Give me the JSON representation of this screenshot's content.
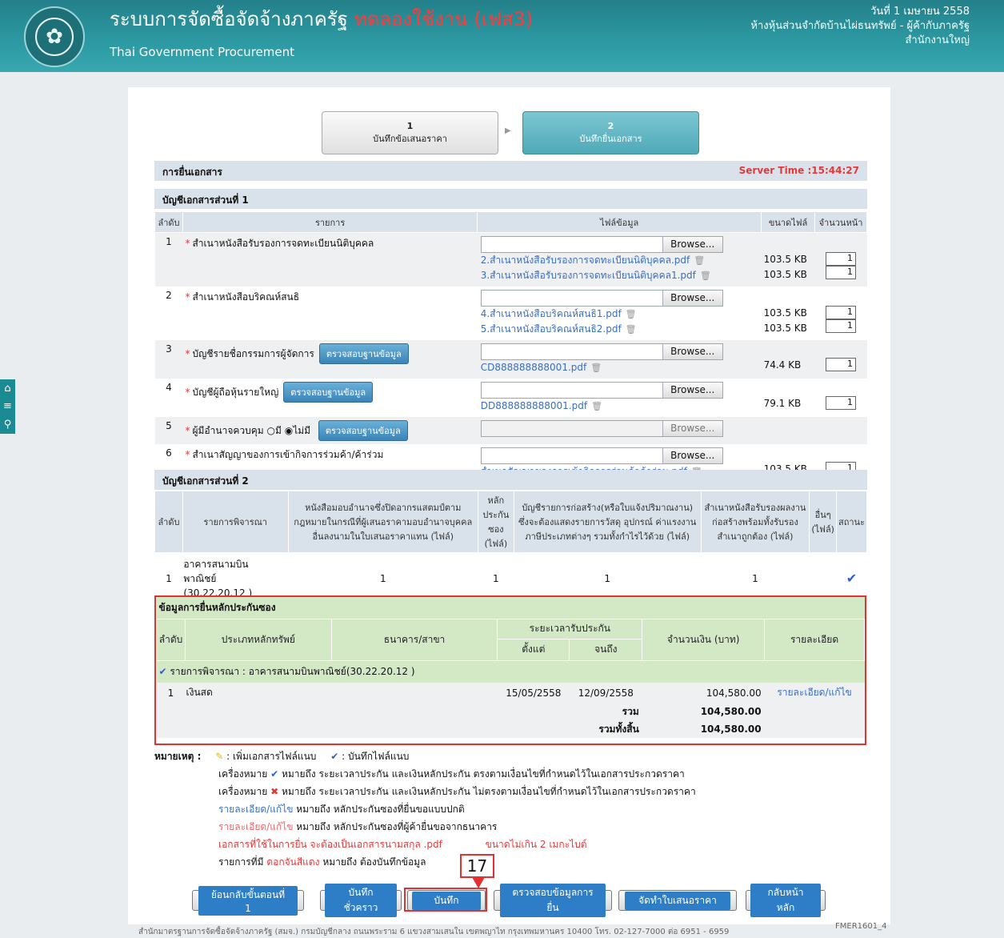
{
  "header": {
    "title": "ระบบการจัดซื้อจัดจ้างภาครัฐ",
    "title_test": "ทดลองใช้งาน (เฟส3)",
    "subtitle": "Thai Government Procurement",
    "date": "วันที่ 1 เมษายน 2558",
    "company": "ห้างหุ้นส่วนจำกัดบ้านไผ่ธนทรัพย์ - ผู้ค้ากับภาครัฐ",
    "branch": "สำนักงานใหญ่"
  },
  "steps": [
    {
      "num": "1",
      "label": "บันทึกข้อเสนอราคา"
    },
    {
      "num": "2",
      "label": "บันทึกยื่นเอกสาร"
    }
  ],
  "section_title": "การยื่นเอกสาร",
  "server_time": "Server Time :15:44:27",
  "part1": {
    "title": "บัญชีเอกสารส่วนที่ 1",
    "headers": [
      "ลำดับ",
      "รายการ",
      "ไฟล์ข้อมูล",
      "ขนาดไฟล์",
      "จำนวนหน้า"
    ],
    "browse": "Browse...",
    "verify": "ตรวจสอบฐานข้อมูล",
    "rows": [
      {
        "no": "1",
        "name": "สำเนาหนังสือรับรองการจดทะเบียนนิติบุคคล",
        "files": [
          {
            "name": "2.สำเนาหนังสือรับรองการจดทะเบียนนิติบุคคล.pdf",
            "size": "103.5 KB",
            "pages": "1"
          },
          {
            "name": "3.สำเนาหนังสือรับรองการจดทะเบียนนิติบุคคล1.pdf",
            "size": "103.5 KB",
            "pages": "1"
          }
        ]
      },
      {
        "no": "2",
        "name": "สำเนาหนังสือบริคณห์สนธิ",
        "files": [
          {
            "name": "4.สำเนาหนังสือบริคณห์สนธิ1.pdf",
            "size": "103.5 KB",
            "pages": "1"
          },
          {
            "name": "5.สำเนาหนังสือบริคณห์สนธิ2.pdf",
            "size": "103.5 KB",
            "pages": "1"
          }
        ]
      },
      {
        "no": "3",
        "name": "บัญชีรายชื่อกรรมการผู้จัดการ",
        "files": [
          {
            "name": "CD888888888001.pdf",
            "size": "74.4 KB",
            "pages": "1"
          }
        ]
      },
      {
        "no": "4",
        "name": "บัญชีผู้ถือหุ้นรายใหญ่",
        "files": [
          {
            "name": "DD888888888001.pdf",
            "size": "79.1 KB",
            "pages": "1"
          }
        ]
      },
      {
        "no": "5",
        "name": "ผู้มีอำนาจควบคุม",
        "opt_yes": "มี",
        "opt_no": "ไม่มี",
        "files": []
      },
      {
        "no": "6",
        "name": "สำเนาสัญญาของการเข้ากิจการร่วมค้า/ค้าร่วม",
        "files": [
          {
            "name": "สำเนาสัญญาของการเข้ากิจการร่วมค้าค้าร่วม.pdf",
            "size": "103.5 KB",
            "pages": "1"
          }
        ]
      }
    ]
  },
  "part2": {
    "title": "บัญชีเอกสารส่วนที่ 2",
    "headers": [
      "ลำดับ",
      "รายการพิจารณา",
      "หนังสือมอบอำนาจซึ่งปิดอากรแสตมป์ตามกฎหมายในกรณีที่ผู้เสนอราคามอบอำนาจบุคคลอื่นลงนามในใบเสนอราคาแทน (ไฟล์)",
      "หลักประกันซอง (ไฟล์)",
      "บัญชีรายการก่อสร้าง(หรือใบแจ้งปริมาณงาน) ซึ่งจะต้องแสดงรายการวัสดุ อุปกรณ์ ค่าแรงงาน ภาษีประเภทต่างๆ รวมทั้งกำไรไว้ด้วย (ไฟล์)",
      "สำเนาหนังสือรับรองผลงานก่อสร้างพร้อมทั้งรับรองสำเนาถูกต้อง (ไฟล์)",
      "อื่นๆ (ไฟล์)",
      "สถานะ"
    ],
    "row": {
      "no": "1",
      "name_line1": "อาคารสนามบิน",
      "name_line2": "พาณิชย์",
      "name_line3": "(30.22.20.12 )",
      "c1": "1",
      "c2": "1",
      "c3": "1",
      "c4": "1"
    }
  },
  "bid_security": {
    "title": "ข้อมูลการยื่นหลักประกันซอง",
    "headers": {
      "no": "ลำดับ",
      "type": "ประเภทหลักทรัพย์",
      "bank": "ธนาคาร/สาขา",
      "period": "ระยะเวลารับประกัน",
      "from": "ตั้งแต่",
      "to": "จนถึง",
      "amount": "จำนวนเงิน (บาท)",
      "detail": "รายละเอียด"
    },
    "item": "รายการพิจารณา : อาคารสนามบินพาณิชย์(30.22.20.12 )",
    "row": {
      "no": "1",
      "type": "เงินสด",
      "bank": "",
      "from": "15/05/2558",
      "to": "12/09/2558",
      "amount": "104,580.00",
      "link": "รายละเอียด/แก้ไข"
    },
    "sum_label": "รวม",
    "sum": "104,580.00",
    "total_label": "รวมทั้งสิ้น",
    "total": "104,580.00"
  },
  "notes": {
    "label": "หมายเหตุ :",
    "legend_add": ": เพิ่มเอกสารไฟล์แนบ",
    "legend_saved": ": บันทึกไฟล์แนบ",
    "l1_a": "เครื่องหมาย",
    "l1_b": "หมายถึง ระยะเวลาประกัน และเงินหลักประกัน ตรงตามเงื่อนไขที่กำหนดไว้ในเอกสารประกวดราคา",
    "l2_a": "เครื่องหมาย",
    "l2_b": "หมายถึง ระยะเวลาประกัน และเงินหลักประกัน ไม่ตรงตามเงื่อนไขที่กำหนดไว้ในเอกสารประกวดราคา",
    "l3_link": "รายละเอียด/แก้ไข",
    "l3": "หมายถึง หลักประกันซองที่ยื่นขอแบบปกติ",
    "l4_link": "รายละเอียด/แก้ไข",
    "l4": "หมายถึง หลักประกันซองที่ผู้ค้ายื่นขอจากธนาคาร",
    "l5": "เอกสารที่ใช้ในการยื่น จะต้องเป็นเอกสารนามสกุล .pdf",
    "l5_b": "ขนาดไม่เกิน 2 เมกะไบต์",
    "l6_a": "รายการที่มี",
    "l6_red": "ดอกจันสีแดง",
    "l6_b": "หมายถึง ต้องบันทึกข้อมูล"
  },
  "buttons": {
    "back": "ย้อนกลับขั้นตอนที่ 1",
    "draft": "บันทึกชั่วคราว",
    "save": "บันทึก",
    "check": "ตรวจสอบข้อมูลการยื่น",
    "make": "จัดทำใบเสนอราคา",
    "home": "กลับหน้าหลัก"
  },
  "callout": "17",
  "footer": "สำนักมาตรฐานการจัดซื้อจัดจ้างภาครัฐ (สมจ.) กรมบัญชีกลาง ถนนพระราม 6 แขวงสามเสนใน เขตพญาไท กรุงเทพมหานคร 10400 โทร. 02-127-7000 ต่อ 6951 - 6959",
  "form_code": "FMER1601_4",
  "colors": {
    "header": "#2d9aa3",
    "test": "#ff3a3a",
    "highlight": "#e53030",
    "bar": "#d9e2ea",
    "green": "#d3e8c5",
    "link": "#3a6fc0"
  }
}
